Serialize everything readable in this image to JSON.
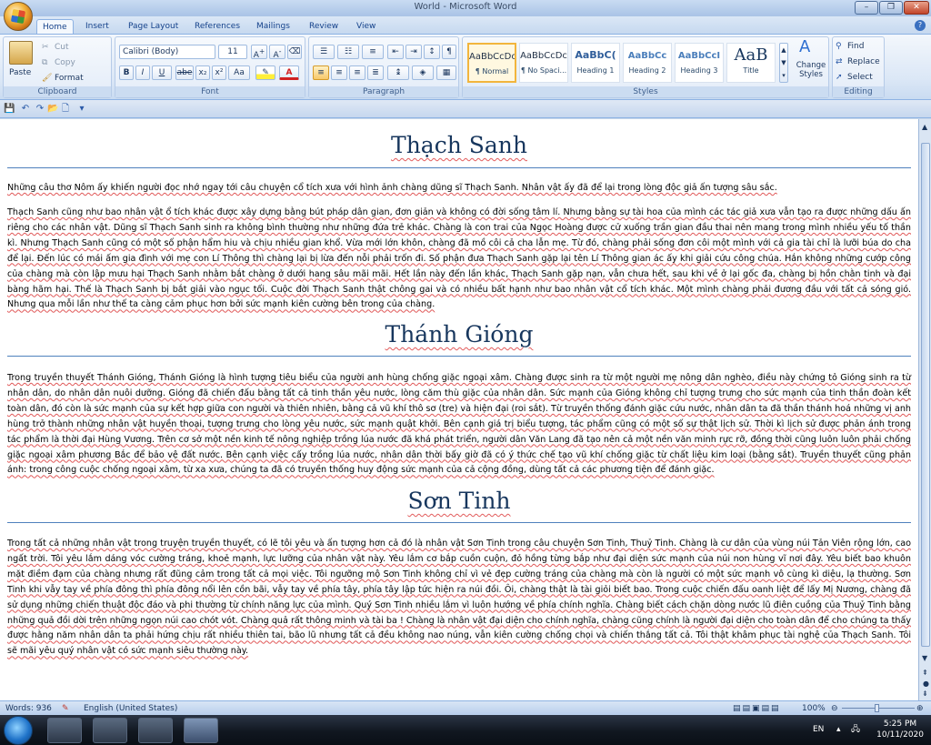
{
  "window": {
    "title": "World - Microsoft Word"
  },
  "tabs": [
    "Home",
    "Insert",
    "Page Layout",
    "References",
    "Mailings",
    "Review",
    "View"
  ],
  "clipboard": {
    "paste": "Paste",
    "cut": "Cut",
    "copy": "Copy",
    "format_painter": "Format Painter",
    "label": "Clipboard"
  },
  "font": {
    "name": "Calibri (Body)",
    "size": "11",
    "label": "Font",
    "bold": "B",
    "italic": "I",
    "underline": "U",
    "strike": "abe",
    "sub": "x₂",
    "sup": "x²",
    "case": "Aa"
  },
  "paragraph": {
    "label": "Paragraph"
  },
  "styles": {
    "label": "Styles",
    "change": "Change Styles",
    "items": [
      {
        "preview": "AaBbCcDc",
        "name": "¶ Normal"
      },
      {
        "preview": "AaBbCcDc",
        "name": "¶ No Spaci..."
      },
      {
        "preview": "AaBbC(",
        "name": "Heading 1"
      },
      {
        "preview": "AaBbCc",
        "name": "Heading 2"
      },
      {
        "preview": "AaBbCcI",
        "name": "Heading 3"
      },
      {
        "preview": "AaB",
        "name": "Title"
      }
    ]
  },
  "editing": {
    "label": "Editing",
    "find": "Find",
    "replace": "Replace",
    "select": "Select"
  },
  "document": {
    "sections": [
      {
        "heading": "Thạch Sanh",
        "paragraphs": [
          "Những câu thơ Nôm ấy khiến người đọc nhớ ngay tới câu chuyện cổ tích xưa với hình ảnh chàng dũng sĩ Thạch Sanh. Nhân vật ấy đã để lại trong lòng độc giả ấn tượng sâu sắc.",
          "Thạch Sanh cũng như bao nhân vật ổ tích khác được xây dựng bằng bút pháp dân gian, đơn giản và không có đời sống tâm lí. Nhưng bằng sự tài hoa của mình các tác giả xưa vẫn tạo ra được những dấu ấn riêng cho các nhân vật. Dũng sĩ Thạch Sanh sinh ra không bình thường như những đứa trẻ khác. Chàng là con trai của Ngọc Hoàng được cử xuống trần gian đầu thai nên mang trong mình nhiều yếu tố thần kì. Nhưng Thạch Sanh cũng có một số phận hẩm hiu và chịu nhiều gian khổ. Vừa mới lớn khôn, chàng đã mồ côi cả cha lẫn mẹ. Từ đó, chàng phải sống đơn côi một mình với cả gia tài chỉ là lưỡi búa do cha để lại. Đến lúc có mái ấm gia đình với mẹ con Lí Thông thì chàng lại bị lừa đến nỗi phải trốn đi. Số phận đưa Thạch Sanh gặp lại tên Lí Thông gian ác ấy khi giải cứu công chúa. Hắn không những cướp công của chàng mà còn lập mưu hại Thạch Sanh nhằm bắt chàng ở dưới hang sâu mãi mãi. Hết lần này đến lần khác, Thạch Sanh gặp nạn, vẫn chưa hết, sau khi về ở lại gốc đa, chàng bị hồn chằn tinh và đại bàng hãm hại. Thế là Thạch Sanh bị bắt giải vào ngục tối. Cuộc đời Thạch Sanh thật chông gai và có nhiều bất hạnh như bao nhân vật cổ tích khác. Một mình chàng phải đương đầu với tất cả sóng gió. Nhưng qua mỗi lần như thế ta càng cảm phục hơn bởi sức mạnh kiên cường bên trong của chàng."
        ]
      },
      {
        "heading": "Thánh Gióng",
        "paragraphs": [
          "Trong truyền thuyết Thánh Gióng, Thánh Gióng là hình tượng tiêu biểu của người anh hùng chống giặc ngoại xâm. Chàng được sinh ra từ một người mẹ nông dân nghèo, điều này chứng tỏ Gióng sinh ra từ nhân dân, do nhân dân nuôi dưỡng. Gióng đã chiến đấu bằng tất cả tinh thần yêu nước, lòng căm thù giặc của nhân dân. Sức mạnh của Gióng không chỉ tượng trưng cho sức mạnh của tinh thần đoàn kết toàn dân, đó còn là sức mạnh của sự kết hợp giữa con người và thiên nhiên, bằng cả vũ khí thô sơ (tre) và hiện đại (roi sắt). Từ truyền thống đánh giặc cứu nước, nhân dân ta đã thần thánh hoá những vị anh hùng trở thành những nhân vật huyền thoại, tượng trưng cho lòng yêu nước, sức mạnh quật khởi. Bên cạnh giá trị biểu tượng, tác phẩm cũng có một số sự thật lịch sử. Thời kì lịch sử được phản ánh trong tác phẩm là thời đại Hùng Vương. Trên cơ sở một nền kinh tế nông nghiệp trồng lúa nước đã khá phát triển, người dân Văn Lang đã tạo nên cả một nền văn minh rực rỡ, đồng thời cũng luôn luôn phải chống giặc ngoại xâm phương Bắc để bảo vệ đất nước. Bên cạnh việc cấy trồng lúa nước, nhân dân thời bấy giờ đã có ý thức chế tạo vũ khí chống giặc từ chất liệu kim loại (bằng sắt). Truyền thuyết cũng phản ánh: trong công cuộc chống ngoại xâm, từ xa xưa, chúng ta đã có truyền thống huy động sức mạnh của cả cộng đồng, dùng tất cả các phương tiện để đánh giặc."
        ]
      },
      {
        "heading": "Sơn Tinh",
        "paragraphs": [
          "Trong tất cả những nhân vật trong truyện truyền thuyết, có lẽ tôi yêu và ấn tượng hơn cả đó là nhân vật Sơn Tinh trong câu chuyện Sơn Tinh, Thuỷ Tinh. Chàng là cư dân của vùng núi Tản Viên rộng lớn, cao ngất trời. Tôi yêu lắm dáng vóc cường tráng, khoẻ mạnh, lực lưỡng của nhân vật này. Yêu lắm cơ bắp cuồn cuộn, đỏ hồng từng bắp như đại diện sức mạnh của núi non hùng vĩ nơi đây. Yêu biết bao khuôn mặt điềm đạm của chàng nhưng rất đũng cảm trong tất cả mọi việc. Tôi ngưỡng mộ Sơn Tinh không chỉ vì vẻ đẹp cường tráng của chàng mà còn là người có một sức mạnh vô cùng kì diệu, lạ thường. Sơn Tinh khi vẫy tay về phía đông thì phía đông nổi lên cồn bãi, vẫy tay về phía tây, phía tây lập tức hiện ra núi đồi. Ôi, chàng thật là tài giỏi biết bao. Trong cuộc chiến đấu oanh liệt để lấy Mị Nương, chàng đã sử dụng những chiến thuật độc đáo và phi thường từ chính năng lực của mình. Quý Sơn Tinh nhiều lắm vì luôn hướng về phía chính nghĩa. Chàng biết cách chặn dòng nước lũ điên cuồng của Thuỷ Tinh bằng những quả đồi dời trên những ngọn núi cao chót vót. Chàng quả rất thông minh và tài ba ! Chàng là nhân vật đại diện cho chính nghĩa, chàng cũng chính là người đại diện cho toàn dân để cho chúng ta thấy được hằng năm nhân dân ta phải hứng chịu rất nhiều thiên tai, bão lũ nhưng tất cả đều không nao núng, vẫn kiên cường chống chọi và chiến thắng tất cả. Tôi thật khâm phục tài nghệ của Thạch Sanh. Tôi sẽ mãi yêu quý nhân vật có sức mạnh siêu thường này."
        ]
      }
    ]
  },
  "status": {
    "words": "Words: 936",
    "language": "English (United States)",
    "zoom": "100%"
  },
  "taskbar": {
    "lang": "EN",
    "time": "5:25 PM",
    "date": "10/11/2020"
  }
}
